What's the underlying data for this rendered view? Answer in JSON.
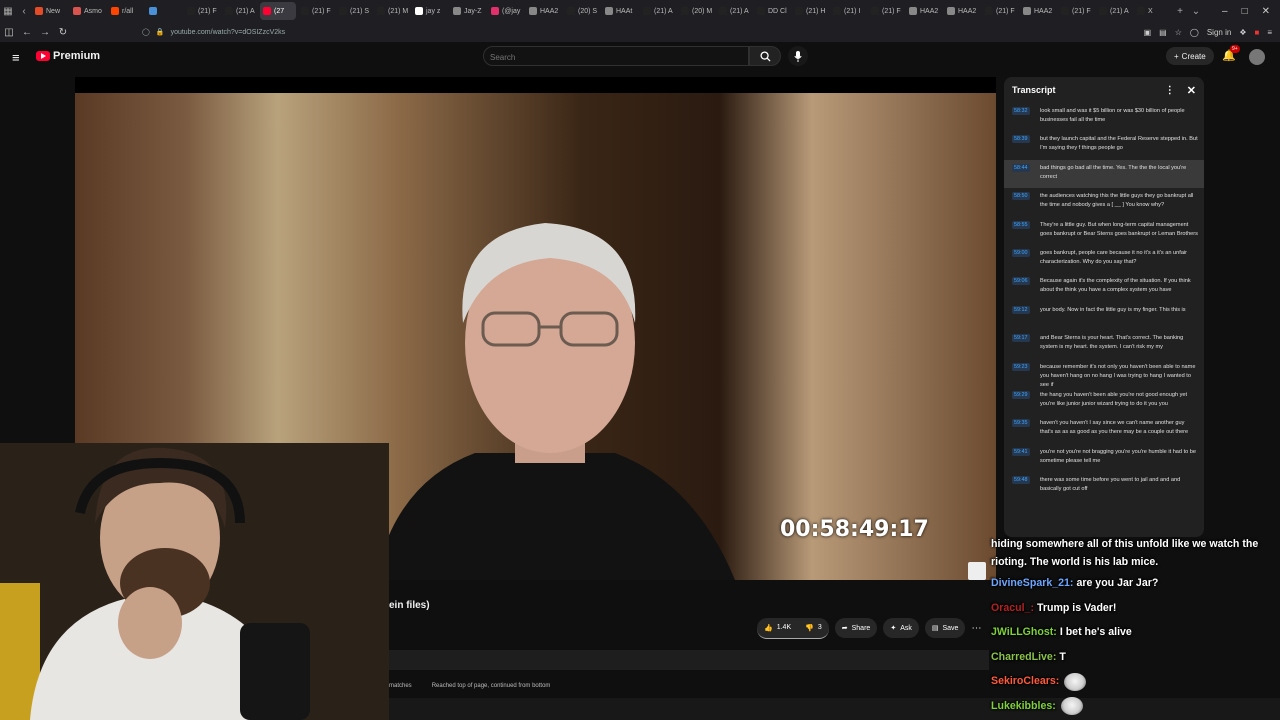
{
  "browser": {
    "tabs": [
      {
        "label": "New",
        "color": "#e34c26"
      },
      {
        "label": "Asmo",
        "color": "#d9534f"
      },
      {
        "label": "r/all",
        "color": "#ff4500"
      },
      {
        "label": "",
        "color": "#4a90d9"
      },
      {
        "label": "(21) F",
        "color": "#222222"
      },
      {
        "label": "(21) A",
        "color": "#222222"
      },
      {
        "label": "(27",
        "color": "#ff0033",
        "active": true
      },
      {
        "label": "(21) F",
        "color": "#222222"
      },
      {
        "label": "(21) S",
        "color": "#222222"
      },
      {
        "label": "(21) M",
        "color": "#222222"
      },
      {
        "label": "jay z",
        "color": "#ffffff"
      },
      {
        "label": "Jay-Z",
        "color": "#888888"
      },
      {
        "label": "(@jay",
        "color": "#e1306c"
      },
      {
        "label": "HAA2",
        "color": "#888888"
      },
      {
        "label": "(20) S",
        "color": "#222222"
      },
      {
        "label": "HAAt",
        "color": "#888888"
      },
      {
        "label": "(21) A",
        "color": "#222222"
      },
      {
        "label": "(20) M",
        "color": "#222222"
      },
      {
        "label": "(21) A",
        "color": "#222222"
      },
      {
        "label": "DD Cl",
        "color": "#222222"
      },
      {
        "label": "(21) H",
        "color": "#222222"
      },
      {
        "label": "(21) I",
        "color": "#222222"
      },
      {
        "label": "(21) F",
        "color": "#222222"
      },
      {
        "label": "HAA2",
        "color": "#888888"
      },
      {
        "label": "HAA2",
        "color": "#888888"
      },
      {
        "label": "(21) F",
        "color": "#222222"
      },
      {
        "label": "HAA2",
        "color": "#888888"
      },
      {
        "label": "(21) F",
        "color": "#222222"
      },
      {
        "label": "(21) A",
        "color": "#222222"
      },
      {
        "label": "X",
        "color": "#222222"
      }
    ],
    "url": "youtube.com/watch?v=dOSIZzcV2ks",
    "signin_label": "Sign in"
  },
  "youtube": {
    "brand": "Premium",
    "search_placeholder": "Search",
    "create_label": "Create",
    "notif_count": "9+",
    "video_title_fragment": "ein files)",
    "likes": "1.4K",
    "dislikes": "3",
    "share_label": "Share",
    "ask_label": "Ask",
    "save_label": "Save",
    "timecode_overlay": "00:58:49:17"
  },
  "find": {
    "matches_label": "matches",
    "status": "Reached top of page, continued from bottom"
  },
  "transcript": {
    "title": "Transcript",
    "rows": [
      {
        "time": "58:32",
        "text": "look small and was it $5 billion or was $30 billion of people businesses fail all the time"
      },
      {
        "time": "58:39",
        "text": "but they launch capital and the Federal Reserve stepped in. But I'm saying they f things people go"
      },
      {
        "time": "58:44",
        "text": "bad things go bad all the time. Yes. The the the local you're correct",
        "active": true
      },
      {
        "time": "58:50",
        "text": "the audiences watching this the little guys they go bankrupt all the time and nobody gives a [ __ ] You know why?"
      },
      {
        "time": "58:55",
        "text": "They're a little guy. But when long-term capital management goes bankrupt or Bear Sterns goes bankrupt or Leman Brothers"
      },
      {
        "time": "59:00",
        "text": "goes bankrupt, people care because it no it's a it's an unfair characterization. Why do you say that?"
      },
      {
        "time": "59:06",
        "text": "Because again it's the complexity of the situation. If you think about the think you have a complex system you have"
      },
      {
        "time": "59:12",
        "text": "your body. Now in fact the little guy is my finger. This this is"
      },
      {
        "time": "59:17",
        "text": "and Bear Sterns is your heart. That's correct. The banking system is my heart. the system. I can't risk my my"
      },
      {
        "time": "59:23",
        "text": "because remember it's not only you haven't been able to name you haven't hang on no hang I was trying to hang I wanted to see if"
      },
      {
        "time": "59:29",
        "text": "the hang you haven't been able you're not good enough yet you're like junior junior wizard trying to do it you you"
      },
      {
        "time": "59:35",
        "text": "haven't you haven't I say since we can't name another guy that's as as as good as you there may be a couple out there"
      },
      {
        "time": "59:41",
        "text": "you're not you're not bragging you're you're humble it had to be sometime please tell me"
      },
      {
        "time": "59:48",
        "text": "there was some time before you went to jail and and and basically got cut off"
      }
    ]
  },
  "chat": {
    "first_line": "hiding somewhere all of this unfold like we watch the rioting. The world is his lab mice.",
    "messages": [
      {
        "user": "DivineSpark_21:",
        "text": "are you Jar Jar?",
        "color": "#6ea6ff"
      },
      {
        "user": "Oracul_:",
        "text": "Trump is Vader!",
        "color": "#b22222"
      },
      {
        "user": "JWiLLGhost:",
        "text": "I bet he's alive",
        "color": "#7fd13b"
      },
      {
        "user": "CharredLive:",
        "text": "T",
        "color": "#8bc34a"
      },
      {
        "user": "SekiroClears:",
        "text": "",
        "color": "#ff5a3c",
        "emote": true
      },
      {
        "user": "Lukekibbles:",
        "text": "",
        "color": "#7fd13b",
        "emote": true
      }
    ]
  }
}
